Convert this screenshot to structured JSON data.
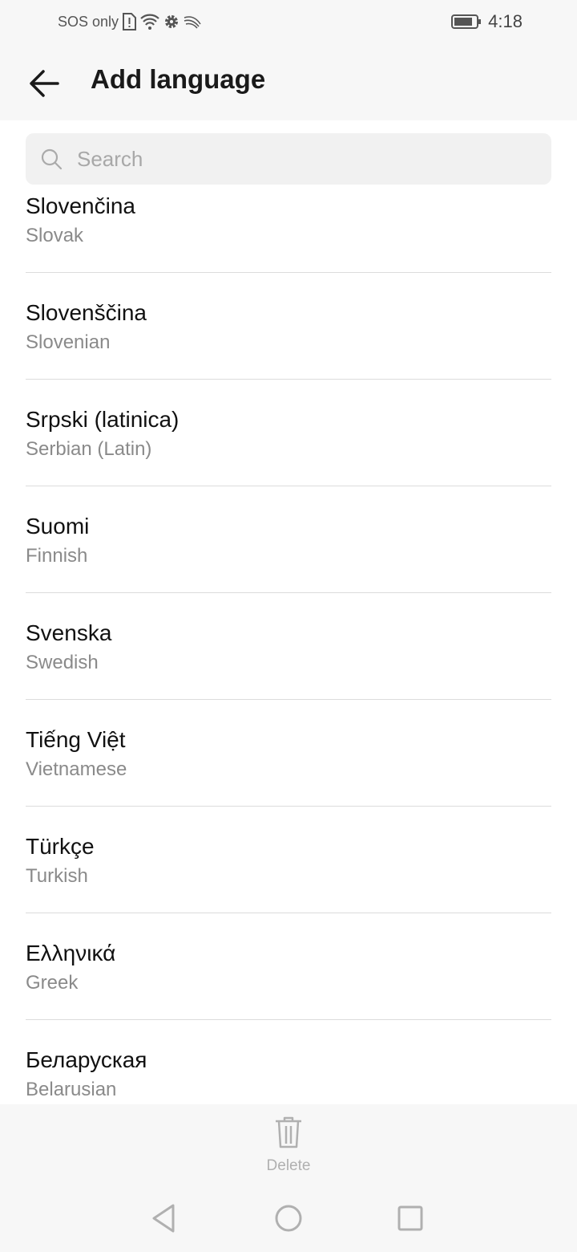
{
  "status_bar": {
    "carrier": "SOS only",
    "time": "4:18",
    "icons": [
      "sim-alert-icon",
      "wifi-icon",
      "settings-icon",
      "swiftkey-icon",
      "battery-icon"
    ]
  },
  "header": {
    "title": "Add language",
    "back_icon": "arrow-left-icon"
  },
  "search": {
    "placeholder": "Search",
    "value": ""
  },
  "languages": [
    {
      "name": "Slovenčina",
      "english": "Slovak"
    },
    {
      "name": "Slovenščina",
      "english": "Slovenian"
    },
    {
      "name": "Srpski (latinica)",
      "english": "Serbian (Latin)"
    },
    {
      "name": "Suomi",
      "english": "Finnish"
    },
    {
      "name": "Svenska",
      "english": "Swedish"
    },
    {
      "name": "Tiếng Việt",
      "english": "Vietnamese"
    },
    {
      "name": "Türkçe",
      "english": "Turkish"
    },
    {
      "name": "Ελληνικά",
      "english": "Greek"
    },
    {
      "name": "Беларуская",
      "english": "Belarusian"
    }
  ],
  "bottom_bar": {
    "delete_label": "Delete",
    "delete_enabled": false
  },
  "colors": {
    "header_bg": "#f7f7f7",
    "search_bg": "#f1f1f1",
    "secondary_text": "#8a8a8a",
    "disabled": "#b0b0b0"
  }
}
